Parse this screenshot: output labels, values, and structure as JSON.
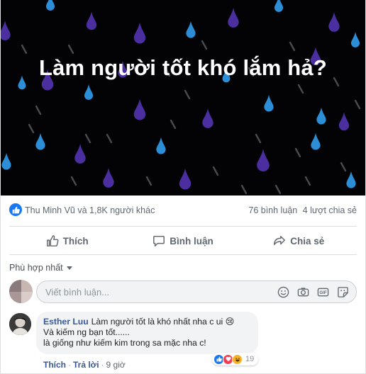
{
  "post": {
    "banner_title": "Làm người tốt khó lắm hả?",
    "colors": {
      "banner_bg": "#030306",
      "raindrop_blue": "#2c8ed6",
      "raindrop_purple": "#4b2ea0",
      "streak": "#4a4a50"
    }
  },
  "stats": {
    "reactors": "Thu Minh Vũ và 1,8K người khác",
    "comments": "76 bình luận",
    "shares": "4 lượt chia sẻ",
    "reaction_icon": "like-icon"
  },
  "actions": {
    "like": "Thích",
    "comment": "Bình luận",
    "share": "Chia sẻ"
  },
  "filter": {
    "label": "Phù hợp nhất"
  },
  "composer": {
    "placeholder": "Viết bình luận...",
    "icons": [
      "emoji-icon",
      "camera-icon",
      "gif-icon",
      "sticker-icon"
    ]
  },
  "comment": {
    "author": "Esther Luu",
    "lines": [
      "Làm người tốt là khó nhất nha c ui 😢",
      "Và kiếm ng bạn tốt......",
      "là giống như kiếm kim trong sa mặc nha c!"
    ],
    "reactions_count": "19",
    "like_label": "Thích",
    "reply_label": "Trả lời",
    "time": "9 giờ"
  }
}
